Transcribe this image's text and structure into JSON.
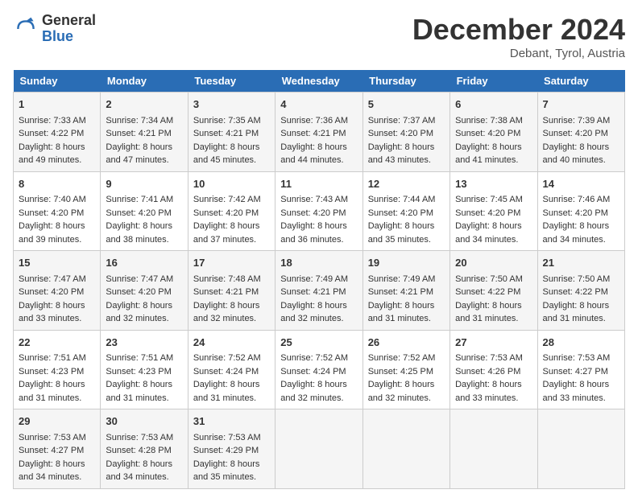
{
  "header": {
    "logo_general": "General",
    "logo_blue": "Blue",
    "month_title": "December 2024",
    "subtitle": "Debant, Tyrol, Austria"
  },
  "weekdays": [
    "Sunday",
    "Monday",
    "Tuesday",
    "Wednesday",
    "Thursday",
    "Friday",
    "Saturday"
  ],
  "weeks": [
    [
      {
        "day": "1",
        "sunrise": "7:33 AM",
        "sunset": "4:22 PM",
        "daylight": "8 hours and 49 minutes."
      },
      {
        "day": "2",
        "sunrise": "7:34 AM",
        "sunset": "4:21 PM",
        "daylight": "8 hours and 47 minutes."
      },
      {
        "day": "3",
        "sunrise": "7:35 AM",
        "sunset": "4:21 PM",
        "daylight": "8 hours and 45 minutes."
      },
      {
        "day": "4",
        "sunrise": "7:36 AM",
        "sunset": "4:21 PM",
        "daylight": "8 hours and 44 minutes."
      },
      {
        "day": "5",
        "sunrise": "7:37 AM",
        "sunset": "4:20 PM",
        "daylight": "8 hours and 43 minutes."
      },
      {
        "day": "6",
        "sunrise": "7:38 AM",
        "sunset": "4:20 PM",
        "daylight": "8 hours and 41 minutes."
      },
      {
        "day": "7",
        "sunrise": "7:39 AM",
        "sunset": "4:20 PM",
        "daylight": "8 hours and 40 minutes."
      }
    ],
    [
      {
        "day": "8",
        "sunrise": "7:40 AM",
        "sunset": "4:20 PM",
        "daylight": "8 hours and 39 minutes."
      },
      {
        "day": "9",
        "sunrise": "7:41 AM",
        "sunset": "4:20 PM",
        "daylight": "8 hours and 38 minutes."
      },
      {
        "day": "10",
        "sunrise": "7:42 AM",
        "sunset": "4:20 PM",
        "daylight": "8 hours and 37 minutes."
      },
      {
        "day": "11",
        "sunrise": "7:43 AM",
        "sunset": "4:20 PM",
        "daylight": "8 hours and 36 minutes."
      },
      {
        "day": "12",
        "sunrise": "7:44 AM",
        "sunset": "4:20 PM",
        "daylight": "8 hours and 35 minutes."
      },
      {
        "day": "13",
        "sunrise": "7:45 AM",
        "sunset": "4:20 PM",
        "daylight": "8 hours and 34 minutes."
      },
      {
        "day": "14",
        "sunrise": "7:46 AM",
        "sunset": "4:20 PM",
        "daylight": "8 hours and 34 minutes."
      }
    ],
    [
      {
        "day": "15",
        "sunrise": "7:47 AM",
        "sunset": "4:20 PM",
        "daylight": "8 hours and 33 minutes."
      },
      {
        "day": "16",
        "sunrise": "7:47 AM",
        "sunset": "4:20 PM",
        "daylight": "8 hours and 32 minutes."
      },
      {
        "day": "17",
        "sunrise": "7:48 AM",
        "sunset": "4:21 PM",
        "daylight": "8 hours and 32 minutes."
      },
      {
        "day": "18",
        "sunrise": "7:49 AM",
        "sunset": "4:21 PM",
        "daylight": "8 hours and 32 minutes."
      },
      {
        "day": "19",
        "sunrise": "7:49 AM",
        "sunset": "4:21 PM",
        "daylight": "8 hours and 31 minutes."
      },
      {
        "day": "20",
        "sunrise": "7:50 AM",
        "sunset": "4:22 PM",
        "daylight": "8 hours and 31 minutes."
      },
      {
        "day": "21",
        "sunrise": "7:50 AM",
        "sunset": "4:22 PM",
        "daylight": "8 hours and 31 minutes."
      }
    ],
    [
      {
        "day": "22",
        "sunrise": "7:51 AM",
        "sunset": "4:23 PM",
        "daylight": "8 hours and 31 minutes."
      },
      {
        "day": "23",
        "sunrise": "7:51 AM",
        "sunset": "4:23 PM",
        "daylight": "8 hours and 31 minutes."
      },
      {
        "day": "24",
        "sunrise": "7:52 AM",
        "sunset": "4:24 PM",
        "daylight": "8 hours and 31 minutes."
      },
      {
        "day": "25",
        "sunrise": "7:52 AM",
        "sunset": "4:24 PM",
        "daylight": "8 hours and 32 minutes."
      },
      {
        "day": "26",
        "sunrise": "7:52 AM",
        "sunset": "4:25 PM",
        "daylight": "8 hours and 32 minutes."
      },
      {
        "day": "27",
        "sunrise": "7:53 AM",
        "sunset": "4:26 PM",
        "daylight": "8 hours and 33 minutes."
      },
      {
        "day": "28",
        "sunrise": "7:53 AM",
        "sunset": "4:27 PM",
        "daylight": "8 hours and 33 minutes."
      }
    ],
    [
      {
        "day": "29",
        "sunrise": "7:53 AM",
        "sunset": "4:27 PM",
        "daylight": "8 hours and 34 minutes."
      },
      {
        "day": "30",
        "sunrise": "7:53 AM",
        "sunset": "4:28 PM",
        "daylight": "8 hours and 34 minutes."
      },
      {
        "day": "31",
        "sunrise": "7:53 AM",
        "sunset": "4:29 PM",
        "daylight": "8 hours and 35 minutes."
      },
      null,
      null,
      null,
      null
    ]
  ],
  "labels": {
    "sunrise": "Sunrise:",
    "sunset": "Sunset:",
    "daylight": "Daylight:"
  }
}
